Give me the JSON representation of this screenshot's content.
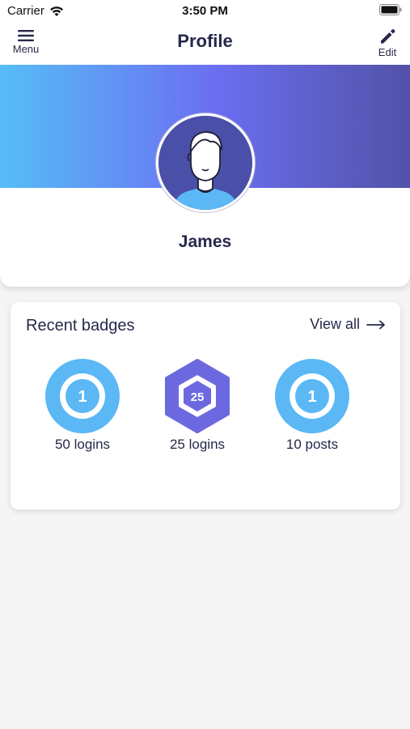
{
  "status_bar": {
    "carrier": "Carrier",
    "time": "3:50 PM"
  },
  "nav": {
    "menu_label": "Menu",
    "title": "Profile",
    "edit_label": "Edit"
  },
  "profile": {
    "name": "James",
    "avatar_icon": "person-avatar-icon"
  },
  "badges": {
    "title": "Recent badges",
    "view_all_label": "View all",
    "items": [
      {
        "label": "50 logins",
        "number": "1",
        "shape": "circle",
        "color": "#5bb8f5"
      },
      {
        "label": "25 logins",
        "number": "25",
        "shape": "hexagon",
        "color": "#6c69e0"
      },
      {
        "label": "10 posts",
        "number": "1",
        "shape": "circle",
        "color": "#5bb8f5"
      }
    ]
  },
  "colors": {
    "header_gradient_start": "#56bdf7",
    "header_gradient_mid": "#6b6ff2",
    "header_gradient_end": "#5252a8",
    "text_primary": "#26284a",
    "background": "#f5f5f5"
  }
}
